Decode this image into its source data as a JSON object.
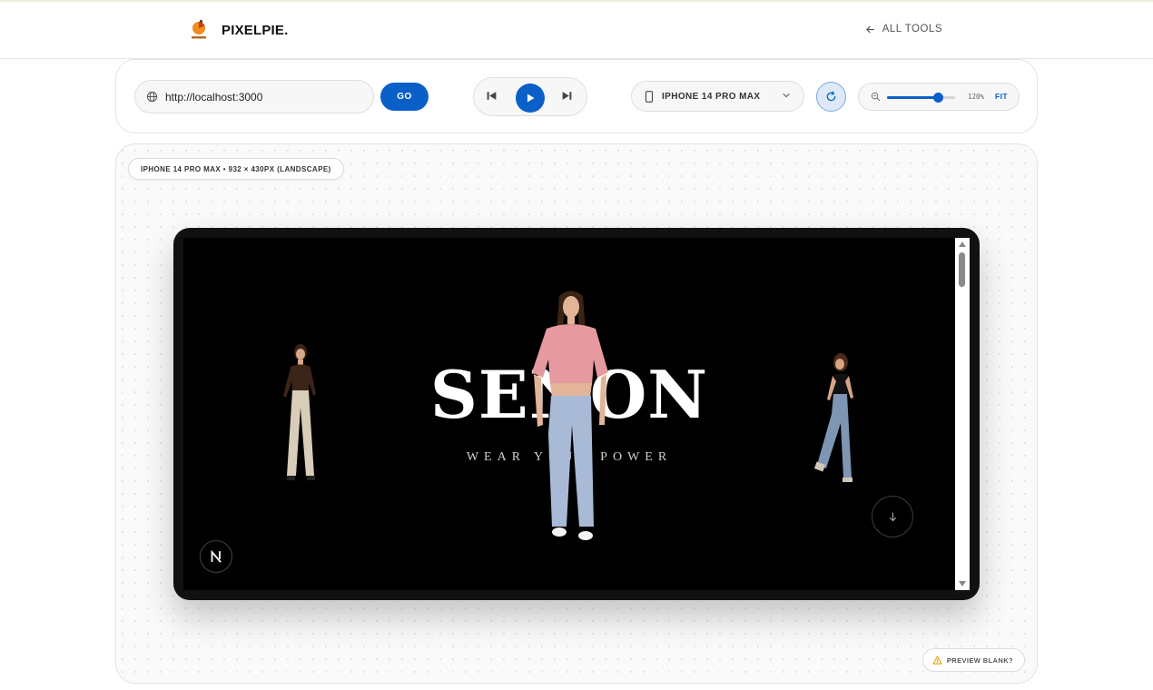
{
  "brand": {
    "name": "PIXELPIE.",
    "logo_caption": "PixelPie"
  },
  "header": {
    "all_tools_label": "ALL TOOLS",
    "back_icon": "arrow-left-icon"
  },
  "toolbar": {
    "url_value": "http://localhost:3000",
    "go_label": "GO",
    "device_name": "IPHONE 14 PRO MAX",
    "zoom_text": "120%",
    "zoom_level": 0.75,
    "fit_label": "FIT"
  },
  "stage": {
    "device_label": "IPHONE 14 PRO MAX • 932 × 430PX (LANDSCAPE)",
    "preview_blank_label": "PREVIEW BLANK?"
  },
  "site": {
    "title": "SENON",
    "tagline": "WEAR YOUR POWER",
    "badge_letter": "N"
  },
  "colors": {
    "accent": "#0a5fc8",
    "screen_bg": "#000000",
    "frame": "#111111"
  }
}
